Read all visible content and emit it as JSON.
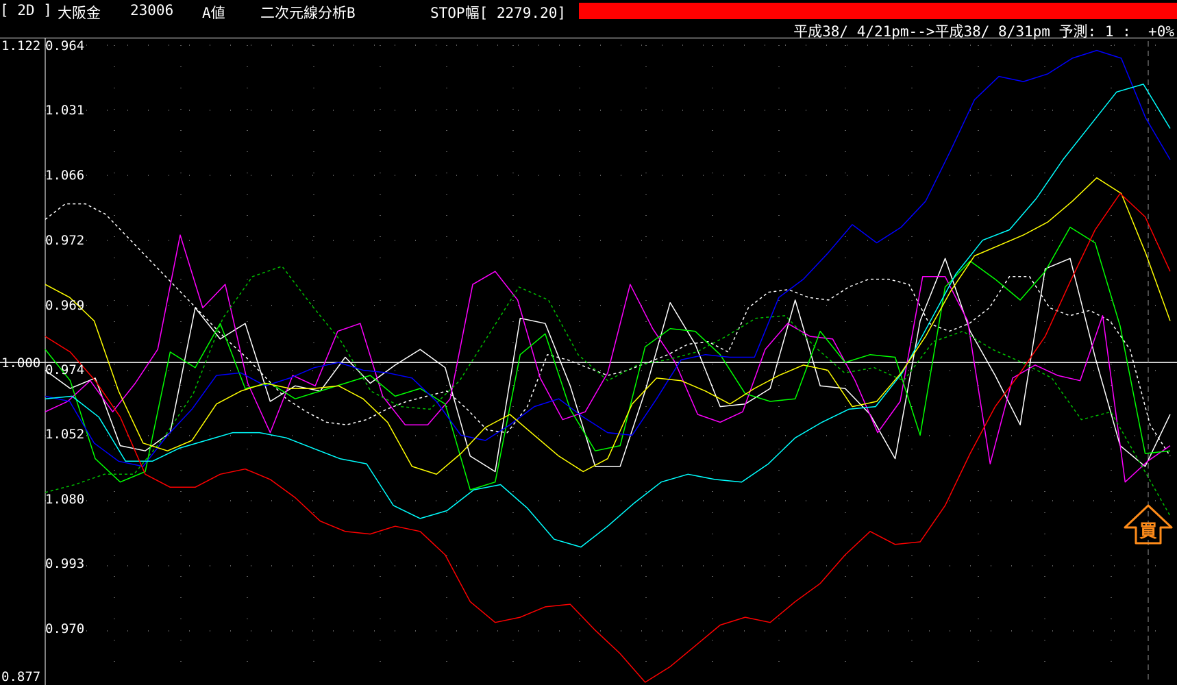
{
  "header": {
    "freq": "[ 2D ]",
    "name": "大阪金",
    "code": "23006",
    "value_type": "A値",
    "method": "二次元線分析B",
    "stop_width": "STOP幅[ 2279.20]",
    "period": "平成38/ 4/21pm-->平成38/ 8/31pm 予測: 1 :  +0%"
  },
  "colors": {
    "background": "#000000",
    "stop_bar": "#ff0000",
    "signal": "#ff8c1a"
  },
  "chart_data": {
    "type": "line",
    "left_axis": {
      "top": "1.122",
      "mid": "1.000",
      "bottom": "0.877",
      "ylim": [
        0.877,
        1.122
      ]
    },
    "band_labels": [
      "0.964",
      "1.031",
      "1.066",
      "0.972",
      "0.969",
      "0.974",
      "1.052",
      "1.080",
      "0.993",
      "0.970"
    ],
    "x_count": 52,
    "signal": {
      "label": "買",
      "direction": "up",
      "index": 49
    },
    "series": [
      {
        "color": "#ffffff",
        "dashed": true,
        "values": [
          1.055,
          1.061,
          1.061,
          1.057,
          1.049,
          1.041,
          1.033,
          1.025,
          1.017,
          1.009,
          1.002,
          0.994,
          0.986,
          0.981,
          0.977,
          0.976,
          0.978,
          0.982,
          0.985,
          0.987,
          0.989,
          0.982,
          0.974,
          0.973,
          0.983,
          1.003,
          1.001,
          0.998,
          0.995,
          0.997,
          1.0,
          1.003,
          1.007,
          1.008,
          1.004,
          1.021,
          1.027,
          1.028,
          1.025,
          1.024,
          1.029,
          1.032,
          1.032,
          1.03,
          1.015,
          1.012,
          1.015,
          1.021,
          1.033,
          1.033,
          1.021,
          1.018,
          1.02,
          1.016,
          1.005,
          0.976,
          0.964
        ]
      },
      {
        "color": "#ffffff",
        "dashed": false,
        "values": [
          0.997,
          0.99,
          0.994,
          0.968,
          0.966,
          0.973,
          1.021,
          1.009,
          1.015,
          0.985,
          0.991,
          0.989,
          1.002,
          0.992,
          0.999,
          1.005,
          0.998,
          0.964,
          0.958,
          1.017,
          1.015,
          0.991,
          0.96,
          0.96,
          0.989,
          1.023,
          1.007,
          0.983,
          0.984,
          0.99,
          1.024,
          0.991,
          0.99,
          0.98,
          0.963,
          1.016,
          1.04,
          1.012,
          0.995,
          0.976,
          1.036,
          1.04,
          1.002,
          0.968,
          0.96,
          0.98
        ]
      },
      {
        "color": "#ff00ff",
        "dashed": false,
        "values": [
          0.981,
          0.985,
          0.993,
          0.981,
          0.992,
          1.005,
          1.049,
          1.021,
          1.03,
          0.992,
          0.973,
          0.995,
          0.991,
          1.012,
          1.015,
          0.987,
          0.976,
          0.976,
          0.986,
          1.03,
          1.035,
          1.024,
          0.994,
          0.978,
          0.981,
          0.996,
          1.03,
          1.013,
          1.0,
          0.98,
          0.977,
          0.981,
          1.005,
          1.015,
          1.01,
          1.009,
          0.993,
          0.973,
          0.985,
          1.033,
          1.033,
          1.016,
          0.961,
          0.994,
          0.999,
          0.995,
          0.993,
          1.018,
          0.954,
          0.962,
          0.968
        ]
      },
      {
        "color": "#00ff00",
        "dashed": false,
        "values": [
          1.005,
          0.993,
          0.963,
          0.954,
          0.958,
          1.004,
          0.998,
          1.015,
          0.99,
          0.992,
          0.986,
          0.989,
          0.992,
          0.995,
          0.987,
          0.99,
          0.984,
          0.951,
          0.954,
          1.003,
          1.011,
          0.982,
          0.966,
          0.968,
          1.006,
          1.013,
          1.012,
          1.003,
          0.988,
          0.985,
          0.986,
          1.012,
          1.0,
          1.003,
          1.002,
          0.972,
          1.029,
          1.039,
          1.032,
          1.024,
          1.035,
          1.052,
          1.046,
          1.014,
          0.965,
          0.966
        ]
      },
      {
        "color": "#00c000",
        "dashed": true,
        "values": [
          0.95,
          0.953,
          0.957,
          0.957,
          0.971,
          0.988,
          1.017,
          1.033,
          1.037,
          1.022,
          1.008,
          0.989,
          0.983,
          0.982,
          0.993,
          1.011,
          1.029,
          1.024,
          1.003,
          0.993,
          0.999,
          1.001,
          1.004,
          1.01,
          1.017,
          1.018,
          1.006,
          0.996,
          0.998,
          0.993,
          1.008,
          1.012,
          1.005,
          1.0,
          0.994,
          0.978,
          0.981,
          0.961,
          0.941
        ]
      },
      {
        "color": "#0000ff",
        "dashed": false,
        "values": [
          0.987,
          0.985,
          0.969,
          0.962,
          0.96,
          0.972,
          0.982,
          0.995,
          0.996,
          0.991,
          0.994,
          0.998,
          1.0,
          0.997,
          0.996,
          0.994,
          0.985,
          0.972,
          0.97,
          0.976,
          0.983,
          0.986,
          0.979,
          0.973,
          0.972,
          0.986,
          1.001,
          1.003,
          1.002,
          1.002,
          1.025,
          1.032,
          1.042,
          1.053,
          1.046,
          1.052,
          1.062,
          1.081,
          1.101,
          1.11,
          1.108,
          1.111,
          1.117,
          1.12,
          1.117,
          1.094,
          1.078
        ]
      },
      {
        "color": "#00ffff",
        "dashed": false,
        "values": [
          0.986,
          0.987,
          0.979,
          0.962,
          0.962,
          0.967,
          0.97,
          0.973,
          0.973,
          0.971,
          0.967,
          0.963,
          0.961,
          0.945,
          0.94,
          0.943,
          0.951,
          0.953,
          0.944,
          0.932,
          0.929,
          0.937,
          0.946,
          0.954,
          0.957,
          0.955,
          0.954,
          0.961,
          0.971,
          0.977,
          0.982,
          0.983,
          0.996,
          1.015,
          1.034,
          1.047,
          1.051,
          1.063,
          1.078,
          1.091,
          1.104,
          1.107,
          1.09
        ]
      },
      {
        "color": "#ffff00",
        "dashed": false,
        "values": [
          1.03,
          1.025,
          1.016,
          0.989,
          0.969,
          0.966,
          0.97,
          0.984,
          0.989,
          0.992,
          0.99,
          0.99,
          0.991,
          0.986,
          0.977,
          0.96,
          0.957,
          0.965,
          0.975,
          0.98,
          0.972,
          0.964,
          0.958,
          0.963,
          0.984,
          0.994,
          0.993,
          0.989,
          0.984,
          0.99,
          0.995,
          0.999,
          0.997,
          0.983,
          0.985,
          0.996,
          1.01,
          1.027,
          1.041,
          1.045,
          1.049,
          1.054,
          1.062,
          1.071,
          1.065,
          1.042,
          1.016
        ]
      },
      {
        "color": "#ff0000",
        "dashed": false,
        "values": [
          1.01,
          1.004,
          0.993,
          0.979,
          0.957,
          0.952,
          0.952,
          0.957,
          0.959,
          0.955,
          0.948,
          0.939,
          0.935,
          0.934,
          0.937,
          0.935,
          0.926,
          0.908,
          0.9,
          0.902,
          0.906,
          0.907,
          0.897,
          0.888,
          0.877,
          0.883,
          0.891,
          0.899,
          0.902,
          0.9,
          0.908,
          0.915,
          0.926,
          0.935,
          0.93,
          0.931,
          0.945,
          0.965,
          0.983,
          0.996,
          1.01,
          1.031,
          1.051,
          1.065,
          1.056,
          1.035
        ]
      }
    ]
  }
}
